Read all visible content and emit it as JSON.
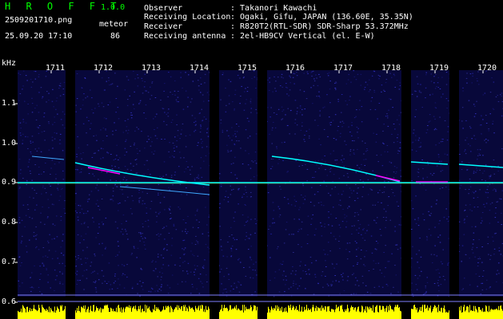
{
  "header": {
    "app_name": "H R O F F T",
    "version": "1.0.0",
    "filename": "2509201710.png",
    "mode": "meteor",
    "datetime": "25.09.20 17:10",
    "count": "86",
    "info_keys": [
      "Observer",
      "Receiving Location",
      "Receiver",
      "Receiving antenna"
    ],
    "info_values": [
      ": Takanori Kawachi",
      ": Ogaki, Gifu, JAPAN (136.60E, 35.35N)",
      ": R820T2(RTL-SDR) SDR-Sharp 53.372MHz",
      ": 2el-HB9CV Vertical (el. E-W)"
    ]
  },
  "axis": {
    "unit": "kHz",
    "y_labels": [
      "1.1",
      "1.0",
      "0.9",
      "0.8",
      "0.7",
      "0.6"
    ],
    "x_labels": [
      "1711",
      "1712",
      "1713",
      "1714",
      "1715",
      "1716",
      "1717",
      "1718",
      "1719",
      "1720"
    ]
  },
  "colors": {
    "header_green": "#00ff00",
    "background": "#000000",
    "noise": "#1e1e8c",
    "carrier": "#00ffff",
    "meteor": "#ff00ff",
    "level": "#ffff00"
  }
}
